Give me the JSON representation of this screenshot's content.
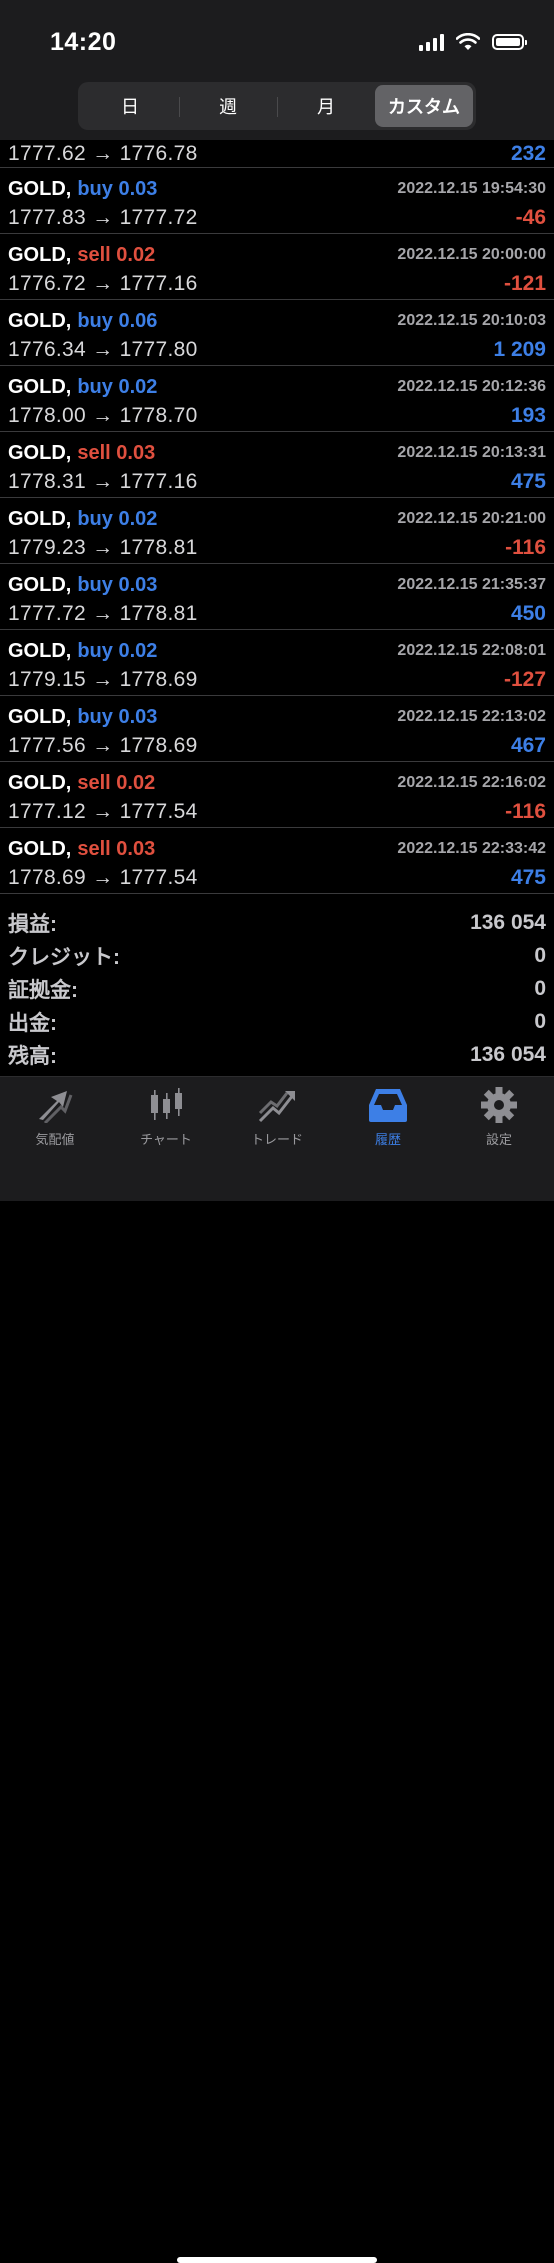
{
  "status_bar": {
    "time": "14:20"
  },
  "segments": [
    {
      "label": "日",
      "active": false
    },
    {
      "label": "週",
      "active": false
    },
    {
      "label": "月",
      "active": false
    },
    {
      "label": "カスタム",
      "active": true
    }
  ],
  "partial_row": {
    "prices": "1777.62 → 1776.78",
    "profit": "232",
    "profit_sign": "pos"
  },
  "deals": [
    {
      "symbol": "GOLD,",
      "side": "buy 0.03",
      "side_type": "buy",
      "datetime": "2022.12.15 19:54:30",
      "prices": "1777.83 → 1777.72",
      "profit": "-46",
      "profit_sign": "neg"
    },
    {
      "symbol": "GOLD,",
      "side": "sell 0.02",
      "side_type": "sell",
      "datetime": "2022.12.15 20:00:00",
      "prices": "1776.72 → 1777.16",
      "profit": "-121",
      "profit_sign": "neg"
    },
    {
      "symbol": "GOLD,",
      "side": "buy 0.06",
      "side_type": "buy",
      "datetime": "2022.12.15 20:10:03",
      "prices": "1776.34 → 1777.80",
      "profit": "1 209",
      "profit_sign": "pos"
    },
    {
      "symbol": "GOLD,",
      "side": "buy 0.02",
      "side_type": "buy",
      "datetime": "2022.12.15 20:12:36",
      "prices": "1778.00 → 1778.70",
      "profit": "193",
      "profit_sign": "pos"
    },
    {
      "symbol": "GOLD,",
      "side": "sell 0.03",
      "side_type": "sell",
      "datetime": "2022.12.15 20:13:31",
      "prices": "1778.31 → 1777.16",
      "profit": "475",
      "profit_sign": "pos"
    },
    {
      "symbol": "GOLD,",
      "side": "buy 0.02",
      "side_type": "buy",
      "datetime": "2022.12.15 20:21:00",
      "prices": "1779.23 → 1778.81",
      "profit": "-116",
      "profit_sign": "neg"
    },
    {
      "symbol": "GOLD,",
      "side": "buy 0.03",
      "side_type": "buy",
      "datetime": "2022.12.15 21:35:37",
      "prices": "1777.72 → 1778.81",
      "profit": "450",
      "profit_sign": "pos"
    },
    {
      "symbol": "GOLD,",
      "side": "buy 0.02",
      "side_type": "buy",
      "datetime": "2022.12.15 22:08:01",
      "prices": "1779.15 → 1778.69",
      "profit": "-127",
      "profit_sign": "neg"
    },
    {
      "symbol": "GOLD,",
      "side": "buy 0.03",
      "side_type": "buy",
      "datetime": "2022.12.15 22:13:02",
      "prices": "1777.56 → 1778.69",
      "profit": "467",
      "profit_sign": "pos"
    },
    {
      "symbol": "GOLD,",
      "side": "sell 0.02",
      "side_type": "sell",
      "datetime": "2022.12.15 22:16:02",
      "prices": "1777.12 → 1777.54",
      "profit": "-116",
      "profit_sign": "neg"
    },
    {
      "symbol": "GOLD,",
      "side": "sell 0.03",
      "side_type": "sell",
      "datetime": "2022.12.15 22:33:42",
      "prices": "1778.69 → 1777.54",
      "profit": "475",
      "profit_sign": "pos"
    }
  ],
  "summary": [
    {
      "label": "損益:",
      "value": "136 054"
    },
    {
      "label": "クレジット:",
      "value": "0"
    },
    {
      "label": "証拠金:",
      "value": "0"
    },
    {
      "label": "出金:",
      "value": "0"
    },
    {
      "label": "残高:",
      "value": "136 054"
    }
  ],
  "tabs": [
    {
      "label": "気配値",
      "icon": "quotes-arrows-icon",
      "active": false
    },
    {
      "label": "チャート",
      "icon": "candlestick-icon",
      "active": false
    },
    {
      "label": "トレード",
      "icon": "trade-trend-icon",
      "active": false
    },
    {
      "label": "履歴",
      "icon": "history-inbox-icon",
      "active": true
    },
    {
      "label": "設定",
      "icon": "gear-icon",
      "active": false
    }
  ],
  "colors": {
    "buy": "#3d7fe6",
    "sell": "#e0503f",
    "background": "#000000",
    "bar": "#1c1c1e"
  }
}
